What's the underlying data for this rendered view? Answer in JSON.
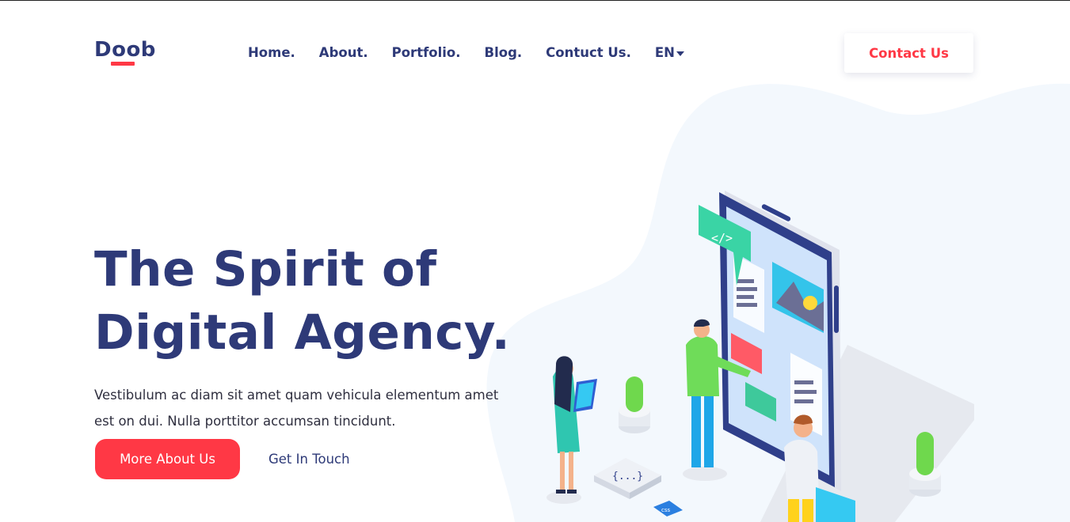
{
  "brand": {
    "name": "Doob",
    "accent": "#ff3845",
    "primary": "#2e3a78"
  },
  "nav": {
    "items": [
      "Home.",
      "About.",
      "Portfolio.",
      "Blog.",
      "Contuct Us."
    ],
    "language": "EN"
  },
  "header": {
    "cta_label": "Contact Us"
  },
  "hero": {
    "title_line1": "The Spirit of",
    "title_line2": "Digital Agency.",
    "description": "Vestibulum ac diam sit amet quam vehicula elementum amet est on dui. Nulla porttitor accumsan tincidunt.",
    "primary_label": "More About Us",
    "secondary_label": "Get In Touch"
  },
  "illustration": {
    "icons": {
      "code_bubble": "</>",
      "braces_tile": "{...}",
      "badge": "css"
    }
  }
}
